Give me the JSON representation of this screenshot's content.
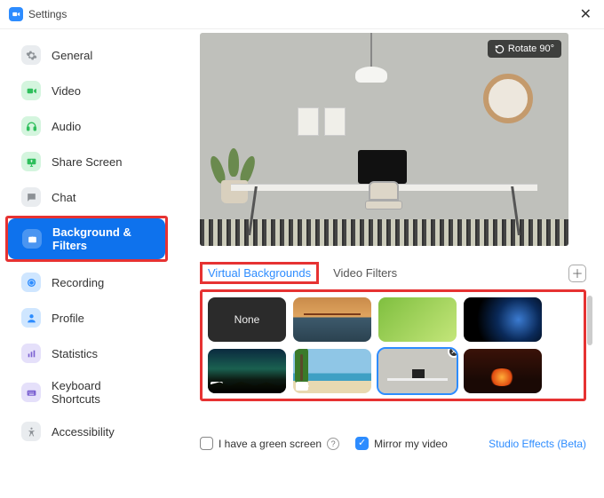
{
  "window": {
    "title": "Settings"
  },
  "sidebar": {
    "items": [
      {
        "label": "General"
      },
      {
        "label": "Video"
      },
      {
        "label": "Audio"
      },
      {
        "label": "Share Screen"
      },
      {
        "label": "Chat"
      },
      {
        "label": "Background & Filters"
      },
      {
        "label": "Recording"
      },
      {
        "label": "Profile"
      },
      {
        "label": "Statistics"
      },
      {
        "label": "Keyboard Shortcuts"
      },
      {
        "label": "Accessibility"
      }
    ],
    "active_index": 5
  },
  "preview": {
    "rotate_label": "Rotate 90°"
  },
  "tabs": {
    "items": [
      {
        "label": "Virtual Backgrounds"
      },
      {
        "label": "Video Filters"
      }
    ],
    "active_index": 0
  },
  "thumbs": {
    "none_label": "None",
    "selected_index": 6
  },
  "footer": {
    "green_screen_label": "I have a green screen",
    "green_screen_checked": false,
    "mirror_label": "Mirror my video",
    "mirror_checked": true,
    "studio_effects_label": "Studio Effects (Beta)"
  }
}
